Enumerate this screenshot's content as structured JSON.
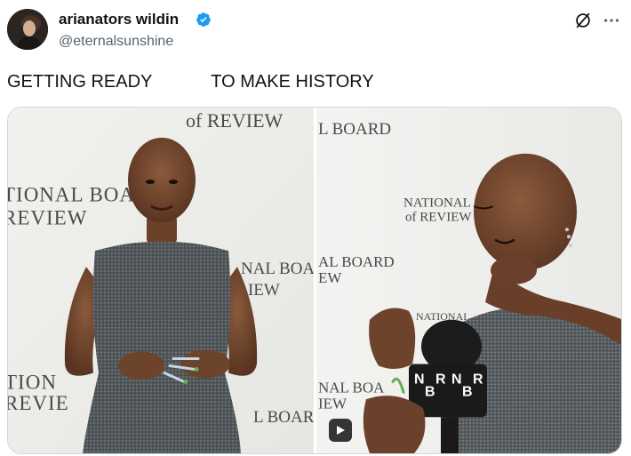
{
  "author": {
    "display_name": "arianators wildin",
    "handle": "@eternalsunshine",
    "verified": true,
    "avatar_icon": "profile-avatar"
  },
  "actions": {
    "grok_icon": "grok-slash-icon",
    "more_icon": "more-horizontal-icon"
  },
  "tweet": {
    "text": "GETTING READY            TO MAKE HISTORY"
  },
  "media": {
    "left_photo_backdrop_lines": [
      "of REVIEW",
      "TIONAL BOA",
      "REVIEW",
      "NAL BOA",
      "IEW",
      "TION",
      "REVIE",
      "L BOAR"
    ],
    "right_video_backdrop_lines": [
      "L BOARD",
      "NATIONAL",
      "of REVIEW",
      "AL BOARD",
      "EW",
      "NATIONAL",
      "NAL BOA",
      "IEW"
    ],
    "mic_flag_text": [
      "N",
      "B",
      "R"
    ],
    "play_icon": "play-icon"
  },
  "colors": {
    "text_primary": "#0f1419",
    "text_secondary": "#536471",
    "verified_blue": "#1d9bf0",
    "border": "#cfd9de"
  }
}
